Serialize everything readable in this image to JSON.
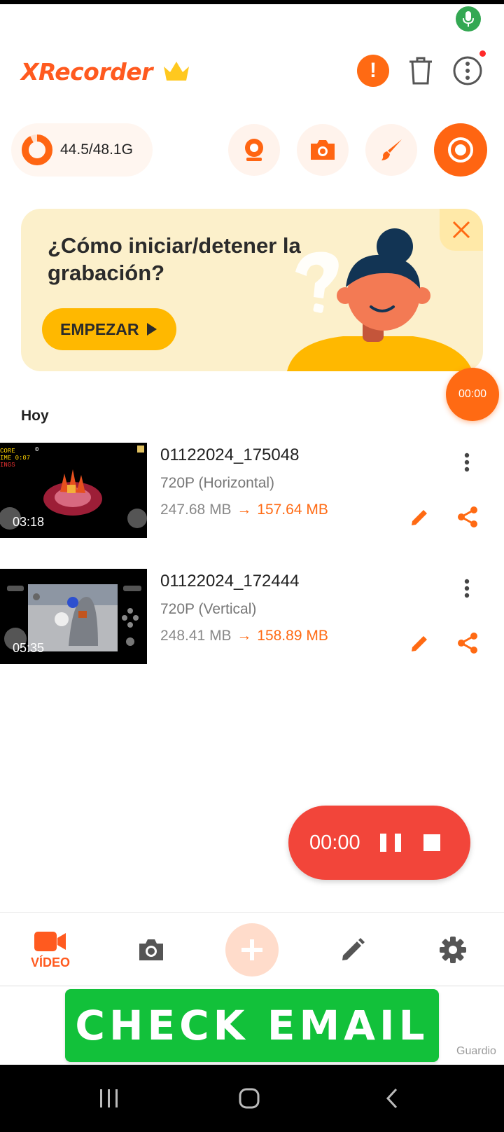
{
  "app": {
    "logo_text": "XRecorder"
  },
  "storage": {
    "used_label": "44.5/48.1G",
    "used_fraction": 0.925
  },
  "tutorial": {
    "title": "¿Cómo iniciar/detener la grabación?",
    "cta_label": "EMPEZAR"
  },
  "floating_timer": "00:00",
  "section_label": "Hoy",
  "recordings": [
    {
      "name": "01122024_175048",
      "quality": "720P (Horizontal)",
      "size_before": "247.68 MB",
      "arrow": "→",
      "size_after": "157.64 MB",
      "duration": "03:18"
    },
    {
      "name": "01122024_172444",
      "quality": "720P (Vertical)",
      "size_before": "248.41 MB",
      "arrow": "→",
      "size_after": "158.89 MB",
      "duration": "05:35"
    }
  ],
  "recording_controls": {
    "time": "00:00"
  },
  "bottom_nav": {
    "video_label": "VÍDEO"
  },
  "ad": {
    "button_label": "CHECK EMAIL",
    "source": "Guardio"
  },
  "colors": {
    "accent": "#ff6512",
    "record_red": "#f2453a",
    "banner_bg": "#fcf0cb",
    "cta_yellow": "#ffb800",
    "ad_green": "#12c13a"
  }
}
